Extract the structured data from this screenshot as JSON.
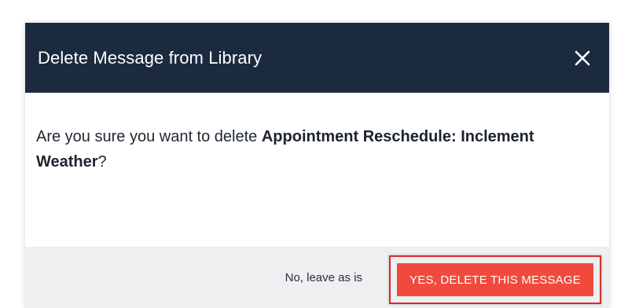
{
  "dialog": {
    "title": "Delete Message from Library",
    "close_icon": "close-icon",
    "body": {
      "prefix": "Are you sure you want to delete ",
      "message_name": "Appointment Reschedule: Inclement Weather",
      "suffix": "?"
    },
    "footer": {
      "cancel_label": "No, leave as is",
      "confirm_label": "YES, DELETE THIS MESSAGE"
    }
  },
  "colors": {
    "header_bg": "#1c2a40",
    "footer_bg": "#eeeff1",
    "confirm_bg": "#f04a3c",
    "highlight_border": "#d62b2b"
  }
}
